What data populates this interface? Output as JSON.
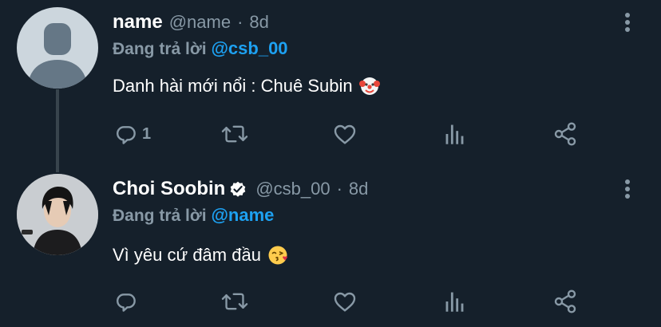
{
  "colors": {
    "background": "#15202b",
    "primary_text": "#ffffff",
    "secondary_text": "#8899a6",
    "mention": "#1da1f2",
    "thread_line": "#38444d",
    "verified": "#ffffff"
  },
  "tweets": [
    {
      "display_name": "name",
      "handle": "@name",
      "separator": "·",
      "time": "8d",
      "replying_prefix": "Đang trả lời",
      "replying_to": "@csb_00",
      "text": "Danh hài mới nổi : Chuê Subin",
      "emoji": "clown-face",
      "avatar": "default-avatar",
      "verified": false,
      "actions": {
        "reply_count": "1",
        "retweet_count": "",
        "like_count": ""
      }
    },
    {
      "display_name": "Choi Soobin",
      "handle": "@csb_00",
      "separator": "·",
      "time": "8d",
      "replying_prefix": "Đang trả lời",
      "replying_to": "@name",
      "text": "Vì yêu cứ đâm đầu",
      "emoji": "face-blowing-a-kiss",
      "avatar": "profile-photo",
      "verified": true,
      "actions": {
        "reply_count": "",
        "retweet_count": "",
        "like_count": ""
      }
    }
  ],
  "icons": {
    "reply": "reply-icon",
    "retweet": "retweet-icon",
    "like": "heart-icon",
    "analytics": "analytics-icon",
    "share": "share-icon",
    "more": "more-vertical-icon",
    "verified": "verified-badge-icon"
  }
}
